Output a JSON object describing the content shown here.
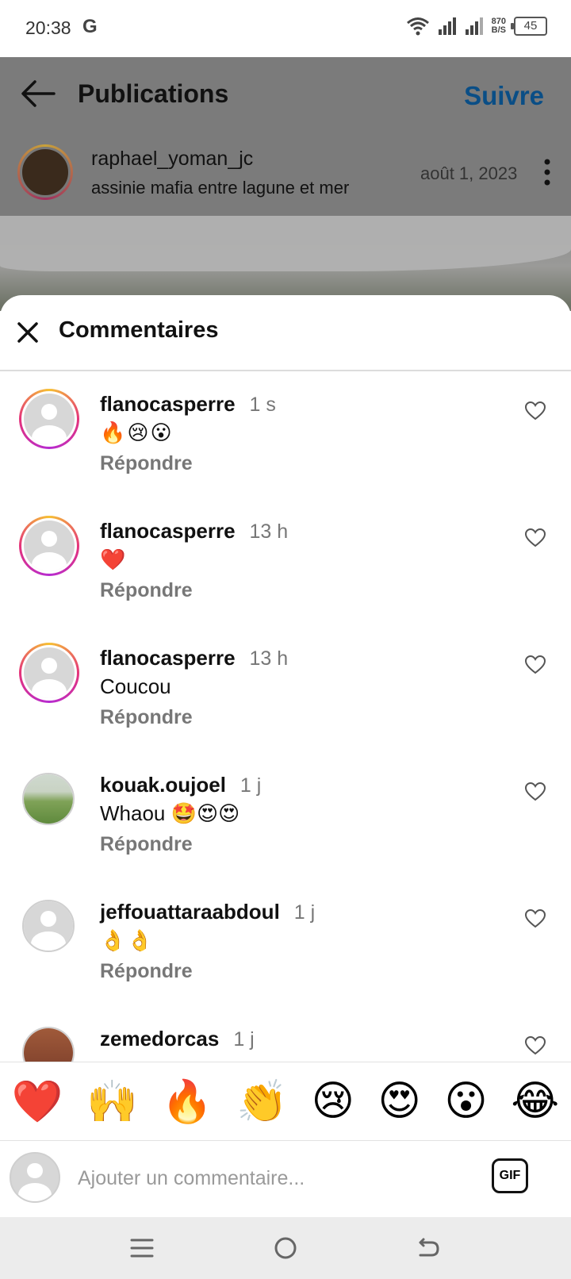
{
  "status": {
    "time": "20:38",
    "g": "G",
    "speed_top": "870",
    "speed_unit": "B/S",
    "battery": "45"
  },
  "header": {
    "title": "Publications",
    "follow": "Suivre"
  },
  "post": {
    "author": "raphael_yoman_jc",
    "location": "assinie mafia entre lagune et mer",
    "date": "août 1, 2023"
  },
  "sheet": {
    "title": "Commentaires"
  },
  "comments": [
    {
      "user": "flanocasperre",
      "time": "1 s",
      "text": "🔥😢😮",
      "reply": "Répondre"
    },
    {
      "user": "flanocasperre",
      "time": "13 h",
      "text": "❤️",
      "reply": "Répondre"
    },
    {
      "user": "flanocasperre",
      "time": "13 h",
      "text": "Coucou",
      "reply": "Répondre"
    },
    {
      "user": "kouak.oujoel",
      "time": "1 j",
      "text": "Whaou 🤩😍😍",
      "reply": "Répondre"
    },
    {
      "user": "jeffouattaraabdoul",
      "time": "1 j",
      "text": "👌👌",
      "reply": "Répondre"
    },
    {
      "user": "zemedorcas",
      "time": "1 j",
      "text": "",
      "reply": ""
    }
  ],
  "emoji_bar": [
    "❤️",
    "🙌",
    "🔥",
    "👏",
    "😢",
    "😍",
    "😮",
    "😂"
  ],
  "input": {
    "placeholder": "Ajouter un commentaire...",
    "gif": "GIF"
  },
  "colors": {
    "follow": "#0a4e86",
    "story_ring_start": "#f6c133",
    "story_ring_end": "#b62bd1",
    "muted_text": "#777777"
  }
}
